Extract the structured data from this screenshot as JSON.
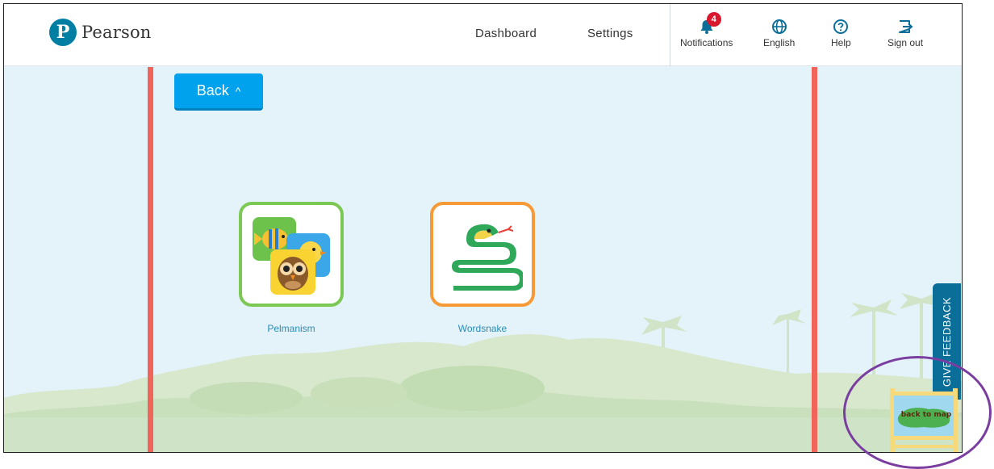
{
  "header": {
    "brand": "Pearson",
    "nav": {
      "dashboard": "Dashboard",
      "settings": "Settings"
    },
    "utilities": {
      "notifications_label": "Notifications",
      "notifications_count": "4",
      "language_label": "English",
      "help_label": "Help",
      "signout_label": "Sign out"
    }
  },
  "main": {
    "back_label": "Back",
    "back_glyph": "^",
    "games": [
      {
        "label": "Pelmanism",
        "border_color": "#7cc855"
      },
      {
        "label": "Wordsnake",
        "border_color": "#f59a36"
      }
    ]
  },
  "side": {
    "feedback_label": "GIVE FEEDBACK",
    "map_sign_label": "back to map"
  },
  "colors": {
    "brand": "#007fa3",
    "accent_button": "#00a1ed",
    "panel_border": "#f0645a",
    "badge": "#d9182e",
    "feedback": "#0b6e99",
    "annotation": "#7a3ea0"
  }
}
